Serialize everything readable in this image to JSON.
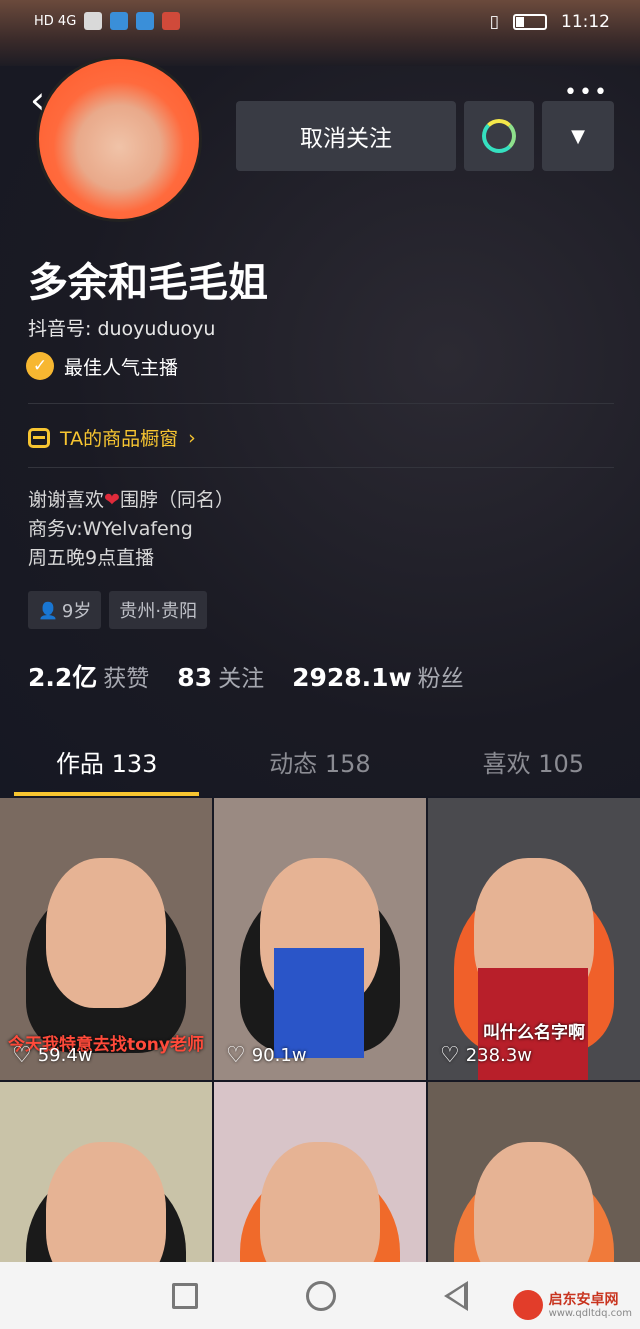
{
  "status_bar": {
    "left_text": "HD 4G",
    "time": "11:12"
  },
  "profile": {
    "unfollow_label": "取消关注",
    "name": "多余和毛毛姐",
    "douyin_id": "抖音号: duoyuduoyu",
    "badge": "最佳人气主播",
    "shop": "TA的商品橱窗",
    "bio_line1_a": "谢谢喜欢",
    "bio_line1_b": "围脖（同名）",
    "bio_line2": "商务v:WYelvafeng",
    "bio_line3": "周五晚9点直播",
    "tag_age": "9岁",
    "tag_location": "贵州·贵阳"
  },
  "stats": {
    "likes_num": "2.2亿",
    "likes_label": "获赞",
    "following_num": "83",
    "following_label": "关注",
    "fans_num": "2928.1w",
    "fans_label": "粉丝"
  },
  "tabs": [
    {
      "label": "作品 133"
    },
    {
      "label": "动态 158"
    },
    {
      "label": "喜欢 105"
    }
  ],
  "videos": [
    {
      "likes": "59.4w",
      "caption": "今天我特意去找tony老师"
    },
    {
      "likes": "90.1w",
      "caption": ""
    },
    {
      "likes": "238.3w",
      "caption": "叫什么名字啊"
    },
    {
      "likes": "",
      "caption": ""
    },
    {
      "likes": "",
      "caption": ""
    },
    {
      "likes": "",
      "caption": ""
    }
  ],
  "watermark": {
    "name": "启东安卓网",
    "url": "www.qdltdq.com"
  },
  "colors": {
    "accent": "#f7c531",
    "background": "#161823",
    "button": "#393b44"
  }
}
